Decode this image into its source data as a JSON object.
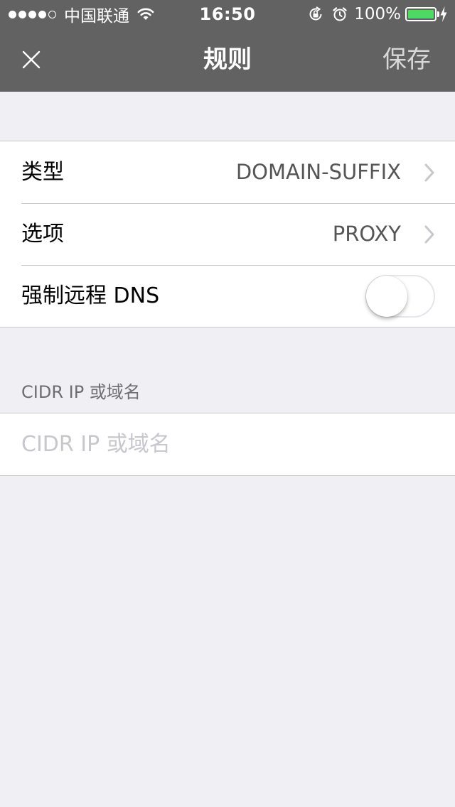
{
  "status_bar": {
    "carrier": "中国联通",
    "time": "16:50",
    "battery_percent": "100%",
    "signal_bars_filled": 4,
    "signal_bars_total": 5,
    "battery_color": "#4cd964",
    "icons": [
      "wifi-icon",
      "orientation-lock-icon",
      "alarm-icon",
      "battery-icon",
      "charging-bolt-icon"
    ]
  },
  "navbar": {
    "title": "规则",
    "save_label": "保存",
    "close_icon": "close-icon",
    "background": "#626262"
  },
  "settings": {
    "type": {
      "label": "类型",
      "value": "DOMAIN-SUFFIX"
    },
    "option": {
      "label": "选项",
      "value": "PROXY"
    },
    "force_remote_dns": {
      "label": "强制远程 DNS",
      "enabled": false
    }
  },
  "cidr_section": {
    "header": "CIDR IP 或域名",
    "input_value": "",
    "input_placeholder": "CIDR IP 或域名"
  }
}
